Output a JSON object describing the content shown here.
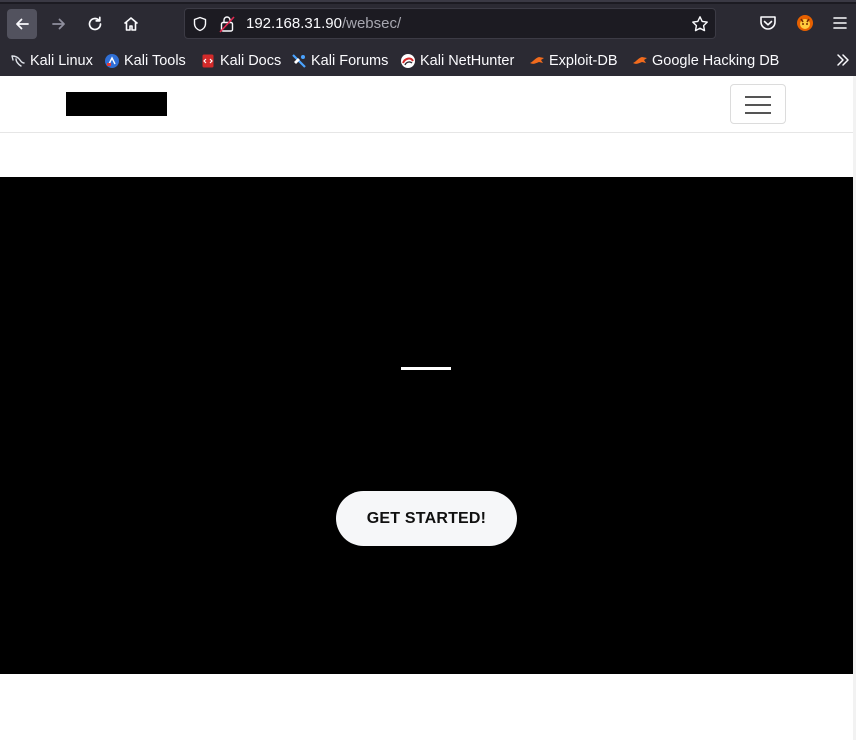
{
  "browser": {
    "url_host": "192.168.31.90",
    "url_path": "/websec/",
    "bookmarks": [
      {
        "label": "Kali Linux",
        "icon": "kali-dragon-icon"
      },
      {
        "label": "Kali Tools",
        "icon": "kali-tools-icon"
      },
      {
        "label": "Kali Docs",
        "icon": "kali-docs-icon"
      },
      {
        "label": "Kali Forums",
        "icon": "kali-forums-icon"
      },
      {
        "label": "Kali NetHunter",
        "icon": "nethunter-icon"
      },
      {
        "label": "Exploit-DB",
        "icon": "exploit-db-icon"
      },
      {
        "label": "Google Hacking DB",
        "icon": "ghdb-icon"
      }
    ]
  },
  "page": {
    "cta_label": "GET STARTED!"
  },
  "colors": {
    "chrome_bg": "#2b2a33",
    "urlbar_bg": "#1c1b22",
    "hero_bg": "#000000",
    "cta_bg": "#f6f7f9"
  }
}
